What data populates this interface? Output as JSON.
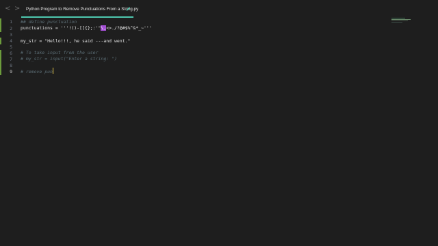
{
  "window": {
    "tab_title": "Python Program to Remove Punctuations From a String.py",
    "nav_back": "<",
    "nav_forward": ">"
  },
  "editor": {
    "line_numbers": [
      "1",
      "2",
      "3",
      "4",
      "5",
      "6",
      "7",
      "8",
      "9"
    ],
    "active_line": "9",
    "lines": {
      "l1": "## define punctuation",
      "l2_name": "punctuations = ",
      "l2_str_a": "'''!()-[]{};:'\"",
      "l2_sel": "\\,",
      "l2_str_b": "<>./?@#$%^&*_~'''",
      "l4": "my_str = \"Hello!!!, he said ---and went.\"",
      "l6": "# To take input from the user",
      "l7": "# my_str = input(\"Enter a string: \")",
      "l9": "# remove pun"
    }
  },
  "colors": {
    "background": "#1e1e1e",
    "tab_underline": "#4ec9b0",
    "comment": "#5c6e76",
    "selection": "#a44fd4",
    "cursor": "#e8c84a",
    "change_marker": "#6c9b3c"
  }
}
